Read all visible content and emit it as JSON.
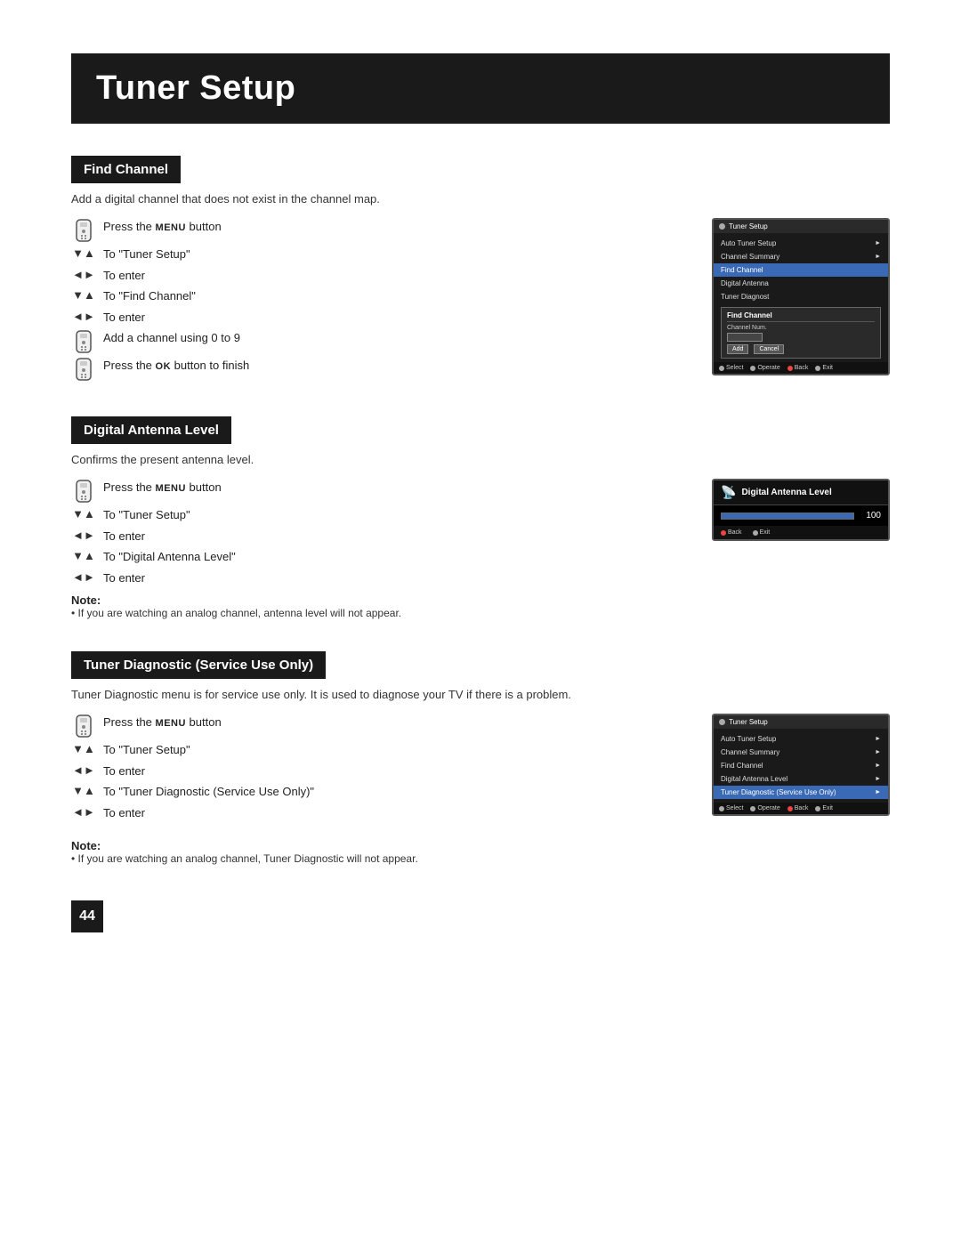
{
  "page": {
    "title": "Tuner Setup",
    "page_number": "44"
  },
  "find_channel": {
    "header": "Find Channel",
    "desc": "Add a digital channel that does not exist in the channel map.",
    "steps": [
      {
        "icon": "remote",
        "text": "Press the MENU button",
        "menu_bold": "MENU"
      },
      {
        "icon": "arrow-ud",
        "text": "To \"Tuner Setup\""
      },
      {
        "icon": "arrow-lr",
        "text": "To enter"
      },
      {
        "icon": "arrow-ud",
        "text": "To \"Find Channel\""
      },
      {
        "icon": "arrow-lr",
        "text": "To enter"
      },
      {
        "icon": "remote",
        "text": "Add a channel using 0 to 9"
      },
      {
        "icon": "remote",
        "text": "Press the Ok button to finish",
        "ok_bold": "OK"
      }
    ],
    "screen": {
      "title": "Tuner Setup",
      "menu_items": [
        {
          "label": "Auto Tuner Setup",
          "arrow": true,
          "highlighted": false
        },
        {
          "label": "Channel Summary",
          "arrow": true,
          "highlighted": false
        },
        {
          "label": "Find Channel",
          "arrow": false,
          "highlighted": true
        },
        {
          "label": "Digital Antenna",
          "arrow": false,
          "highlighted": false
        },
        {
          "label": "Tuner Diagnost",
          "arrow": false,
          "highlighted": false
        }
      ],
      "popup": {
        "title": "Find Channel",
        "label": "Channel Num.",
        "buttons": [
          "Add",
          "Cancel"
        ]
      },
      "footer": [
        "Select",
        "Operate",
        "Back",
        "Exit"
      ]
    }
  },
  "digital_antenna": {
    "header": "Digital Antenna Level",
    "desc": "Confirms the present antenna level.",
    "steps": [
      {
        "icon": "remote",
        "text": "Press the MENU button",
        "menu_bold": "MENU"
      },
      {
        "icon": "arrow-ud",
        "text": "To \"Tuner Setup\""
      },
      {
        "icon": "arrow-lr",
        "text": "To enter"
      },
      {
        "icon": "arrow-ud",
        "text": "To \"Digital Antenna Level\""
      },
      {
        "icon": "arrow-lr",
        "text": "To enter"
      }
    ],
    "screen": {
      "title": "Digital Antenna Level",
      "level_value": 100,
      "level_percent": 100,
      "footer": [
        "Back",
        "Exit"
      ]
    },
    "note_label": "Note:",
    "note_text": "• If you are watching an analog channel, antenna level will not appear."
  },
  "tuner_diagnostic": {
    "header": "Tuner Diagnostic (Service Use Only)",
    "desc": "Tuner Diagnostic menu is for service use only.  It is used to diagnose your TV if there is a problem.",
    "steps": [
      {
        "icon": "remote",
        "text": "Press the MENU button",
        "menu_bold": "MENU"
      },
      {
        "icon": "arrow-ud",
        "text": "To \"Tuner Setup\""
      },
      {
        "icon": "arrow-lr",
        "text": "To enter"
      },
      {
        "icon": "arrow-ud",
        "text": "To \"Tuner Diagnostic (Service Use Only)\""
      },
      {
        "icon": "arrow-lr",
        "text": "To enter"
      }
    ],
    "screen": {
      "title": "Tuner Setup",
      "menu_items": [
        {
          "label": "Auto Tuner Setup",
          "arrow": true,
          "highlighted": false
        },
        {
          "label": "Channel Summary",
          "arrow": true,
          "highlighted": false
        },
        {
          "label": "Find Channel",
          "arrow": true,
          "highlighted": false
        },
        {
          "label": "Digital Antenna Level",
          "arrow": true,
          "highlighted": false
        },
        {
          "label": "Tuner Diagnostic (Service Use Only)",
          "arrow": true,
          "highlighted": true
        }
      ],
      "footer": [
        "Select",
        "Operate",
        "Back",
        "Exit"
      ]
    },
    "note_label": "Note:",
    "note_text": "• If you are watching an analog channel, Tuner Diagnostic will not appear."
  }
}
